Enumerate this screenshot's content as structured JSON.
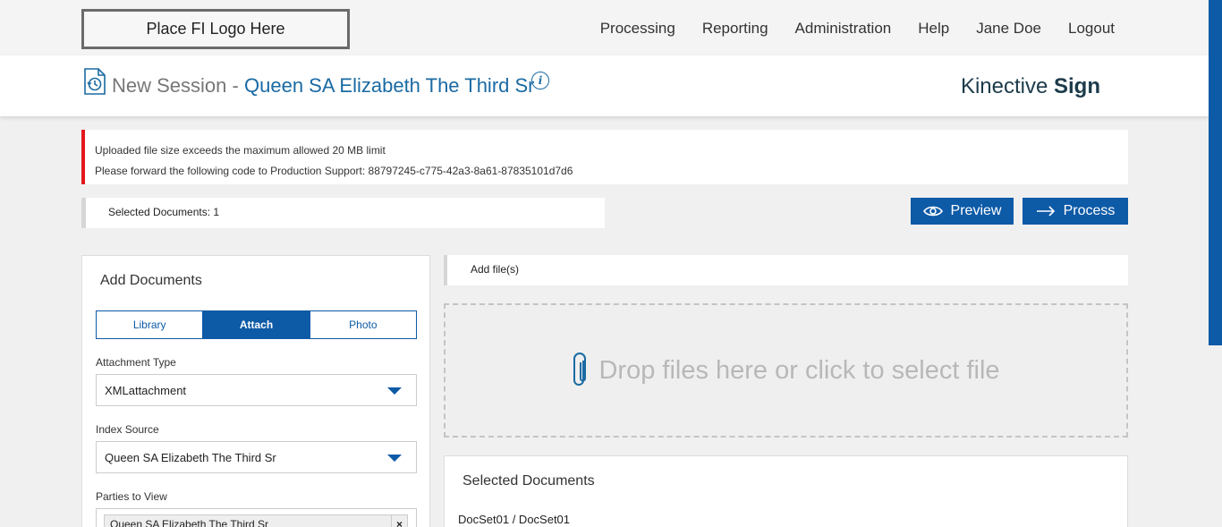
{
  "header": {
    "logo_text": "Place FI Logo Here",
    "nav": [
      "Processing",
      "Reporting",
      "Administration",
      "Help",
      "Jane Doe",
      "Logout"
    ]
  },
  "title": {
    "prefix": "New Session -",
    "name": "Queen SA Elizabeth The Third Sr",
    "brand_light": "Kinective",
    "brand_bold": "Sign",
    "session_icon": "history-document-icon",
    "info_icon": "info-icon"
  },
  "error": {
    "line1": "Uploaded file size exceeds the maximum allowed 20 MB limit",
    "line2": "Please forward the following code to Production Support: 88797245-c775-42a3-8a61-87835101d7d6"
  },
  "toolbar": {
    "selected_documents": "Selected Documents: 1",
    "preview_label": "Preview",
    "process_label": "Process"
  },
  "add_documents": {
    "heading": "Add Documents",
    "tabs": [
      "Library",
      "Attach",
      "Photo"
    ],
    "active_tab": "Attach",
    "attachment_type_label": "Attachment Type",
    "attachment_type_value": "XMLattachment",
    "index_source_label": "Index Source",
    "index_source_value": "Queen SA Elizabeth The Third Sr",
    "parties_label": "Parties to View",
    "parties": [
      "Queen SA Elizabeth The Third Sr"
    ]
  },
  "files": {
    "add_files_label": "Add file(s)",
    "dropzone_text": "Drop files here or click to select file",
    "selected_heading": "Selected Documents",
    "docset": "DocSet01 / DocSet01"
  },
  "colors": {
    "accent": "#0d5aa7",
    "link": "#1a6aa3",
    "error": "#e3171c"
  }
}
